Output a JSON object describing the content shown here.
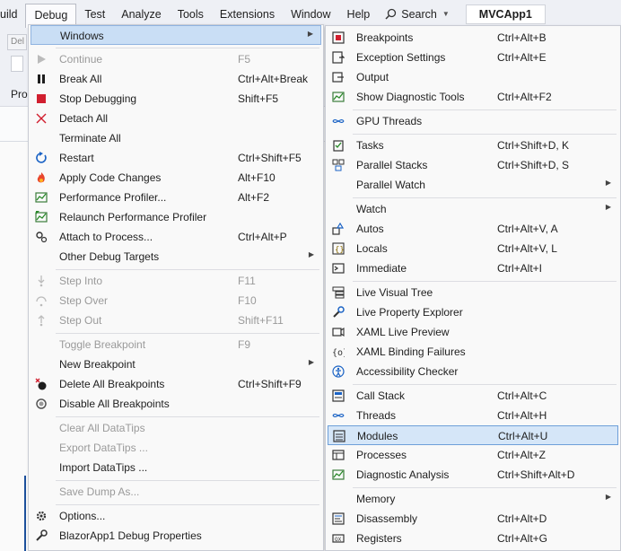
{
  "menubar": {
    "items": [
      "uild",
      "Debug",
      "Test",
      "Analyze",
      "Tools",
      "Extensions",
      "Window",
      "Help"
    ],
    "search_label": "Search",
    "app_name": "MVCApp1"
  },
  "background": {
    "toolbar_hint": "Del",
    "tab_hint": "Pro"
  },
  "debug_menu": {
    "items": [
      {
        "label": "Windows",
        "shortcut": "",
        "icon": "",
        "submenu": true,
        "disabled": false
      },
      {
        "label": "Continue",
        "shortcut": "F5",
        "icon": "continue-icon",
        "submenu": false,
        "disabled": true
      },
      {
        "label": "Break All",
        "shortcut": "Ctrl+Alt+Break",
        "icon": "pause-icon",
        "submenu": false,
        "disabled": false
      },
      {
        "label": "Stop Debugging",
        "shortcut": "Shift+F5",
        "icon": "stop-icon",
        "submenu": false,
        "disabled": false
      },
      {
        "label": "Detach All",
        "shortcut": "",
        "icon": "detach-icon",
        "submenu": false,
        "disabled": false
      },
      {
        "label": "Terminate All",
        "shortcut": "",
        "icon": "",
        "submenu": false,
        "disabled": false
      },
      {
        "label": "Restart",
        "shortcut": "Ctrl+Shift+F5",
        "icon": "restart-icon",
        "submenu": false,
        "disabled": false
      },
      {
        "label": "Apply Code Changes",
        "shortcut": "Alt+F10",
        "icon": "hot-reload-icon",
        "submenu": false,
        "disabled": false
      },
      {
        "label": "Performance Profiler...",
        "shortcut": "Alt+F2",
        "icon": "profiler-icon",
        "submenu": false,
        "disabled": false
      },
      {
        "label": "Relaunch Performance Profiler",
        "shortcut": "",
        "icon": "relaunch-profiler-icon",
        "submenu": false,
        "disabled": false
      },
      {
        "label": "Attach to Process...",
        "shortcut": "Ctrl+Alt+P",
        "icon": "attach-gear-icon",
        "submenu": false,
        "disabled": false
      },
      {
        "label": "Other Debug Targets",
        "shortcut": "",
        "icon": "",
        "submenu": true,
        "disabled": false
      },
      {
        "label": "Step Into",
        "shortcut": "F11",
        "icon": "step-into-icon",
        "submenu": false,
        "disabled": true
      },
      {
        "label": "Step Over",
        "shortcut": "F10",
        "icon": "step-over-icon",
        "submenu": false,
        "disabled": true
      },
      {
        "label": "Step Out",
        "shortcut": "Shift+F11",
        "icon": "step-out-icon",
        "submenu": false,
        "disabled": true
      },
      {
        "label": "Toggle Breakpoint",
        "shortcut": "F9",
        "icon": "",
        "submenu": false,
        "disabled": true
      },
      {
        "label": "New Breakpoint",
        "shortcut": "",
        "icon": "",
        "submenu": true,
        "disabled": false
      },
      {
        "label": "Delete All Breakpoints",
        "shortcut": "Ctrl+Shift+F9",
        "icon": "delete-breakpoints-icon",
        "submenu": false,
        "disabled": false
      },
      {
        "label": "Disable All Breakpoints",
        "shortcut": "",
        "icon": "disable-breakpoints-icon",
        "submenu": false,
        "disabled": false
      },
      {
        "label": "Clear All DataTips",
        "shortcut": "",
        "icon": "",
        "submenu": false,
        "disabled": true
      },
      {
        "label": "Export DataTips ...",
        "shortcut": "",
        "icon": "",
        "submenu": false,
        "disabled": true
      },
      {
        "label": "Import DataTips ...",
        "shortcut": "",
        "icon": "",
        "submenu": false,
        "disabled": false
      },
      {
        "label": "Save Dump As...",
        "shortcut": "",
        "icon": "",
        "submenu": false,
        "disabled": true
      },
      {
        "label": "Options...",
        "shortcut": "",
        "icon": "options-gear-icon",
        "submenu": false,
        "disabled": false
      },
      {
        "label": "BlazorApp1 Debug Properties",
        "shortcut": "",
        "icon": "wrench-icon",
        "submenu": false,
        "disabled": false
      }
    ]
  },
  "windows_menu": {
    "items": [
      {
        "label": "Breakpoints",
        "shortcut": "Ctrl+Alt+B",
        "icon": "breakpoints-window-icon",
        "submenu": false
      },
      {
        "label": "Exception Settings",
        "shortcut": "Ctrl+Alt+E",
        "icon": "exception-settings-icon",
        "submenu": false
      },
      {
        "label": "Output",
        "shortcut": "",
        "icon": "output-icon",
        "submenu": false
      },
      {
        "label": "Show Diagnostic Tools",
        "shortcut": "Ctrl+Alt+F2",
        "icon": "diagnostic-tools-icon",
        "submenu": false
      },
      {
        "label": "GPU Threads",
        "shortcut": "",
        "icon": "gpu-threads-icon",
        "submenu": false
      },
      {
        "label": "Tasks",
        "shortcut": "Ctrl+Shift+D, K",
        "icon": "tasks-icon",
        "submenu": false
      },
      {
        "label": "Parallel Stacks",
        "shortcut": "Ctrl+Shift+D, S",
        "icon": "parallel-stacks-icon",
        "submenu": false
      },
      {
        "label": "Parallel Watch",
        "shortcut": "",
        "icon": "",
        "submenu": true
      },
      {
        "label": "Watch",
        "shortcut": "",
        "icon": "",
        "submenu": true
      },
      {
        "label": "Autos",
        "shortcut": "Ctrl+Alt+V, A",
        "icon": "autos-icon",
        "submenu": false
      },
      {
        "label": "Locals",
        "shortcut": "Ctrl+Alt+V, L",
        "icon": "locals-icon",
        "submenu": false
      },
      {
        "label": "Immediate",
        "shortcut": "Ctrl+Alt+I",
        "icon": "immediate-icon",
        "submenu": false
      },
      {
        "label": "Live Visual Tree",
        "shortcut": "",
        "icon": "live-visual-tree-icon",
        "submenu": false
      },
      {
        "label": "Live Property Explorer",
        "shortcut": "",
        "icon": "live-property-explorer-icon",
        "submenu": false
      },
      {
        "label": "XAML Live Preview",
        "shortcut": "",
        "icon": "xaml-live-preview-icon",
        "submenu": false
      },
      {
        "label": "XAML Binding Failures",
        "shortcut": "",
        "icon": "xaml-binding-failures-icon",
        "submenu": false
      },
      {
        "label": "Accessibility Checker",
        "shortcut": "",
        "icon": "accessibility-icon",
        "submenu": false
      },
      {
        "label": "Call Stack",
        "shortcut": "Ctrl+Alt+C",
        "icon": "call-stack-icon",
        "submenu": false
      },
      {
        "label": "Threads",
        "shortcut": "Ctrl+Alt+H",
        "icon": "threads-icon",
        "submenu": false
      },
      {
        "label": "Modules",
        "shortcut": "Ctrl+Alt+U",
        "icon": "modules-icon",
        "submenu": false
      },
      {
        "label": "Processes",
        "shortcut": "Ctrl+Alt+Z",
        "icon": "processes-icon",
        "submenu": false
      },
      {
        "label": "Diagnostic Analysis",
        "shortcut": "Ctrl+Shift+Alt+D",
        "icon": "diagnostic-analysis-icon",
        "submenu": false
      },
      {
        "label": "Memory",
        "shortcut": "",
        "icon": "",
        "submenu": true
      },
      {
        "label": "Disassembly",
        "shortcut": "Ctrl+Alt+D",
        "icon": "disassembly-icon",
        "submenu": false
      },
      {
        "label": "Registers",
        "shortcut": "Ctrl+Alt+G",
        "icon": "registers-icon",
        "submenu": false
      }
    ]
  },
  "colors": {
    "accent_blue": "#1b4f9c",
    "stop_red": "#d11f2f",
    "highlight": "#c9def5"
  }
}
